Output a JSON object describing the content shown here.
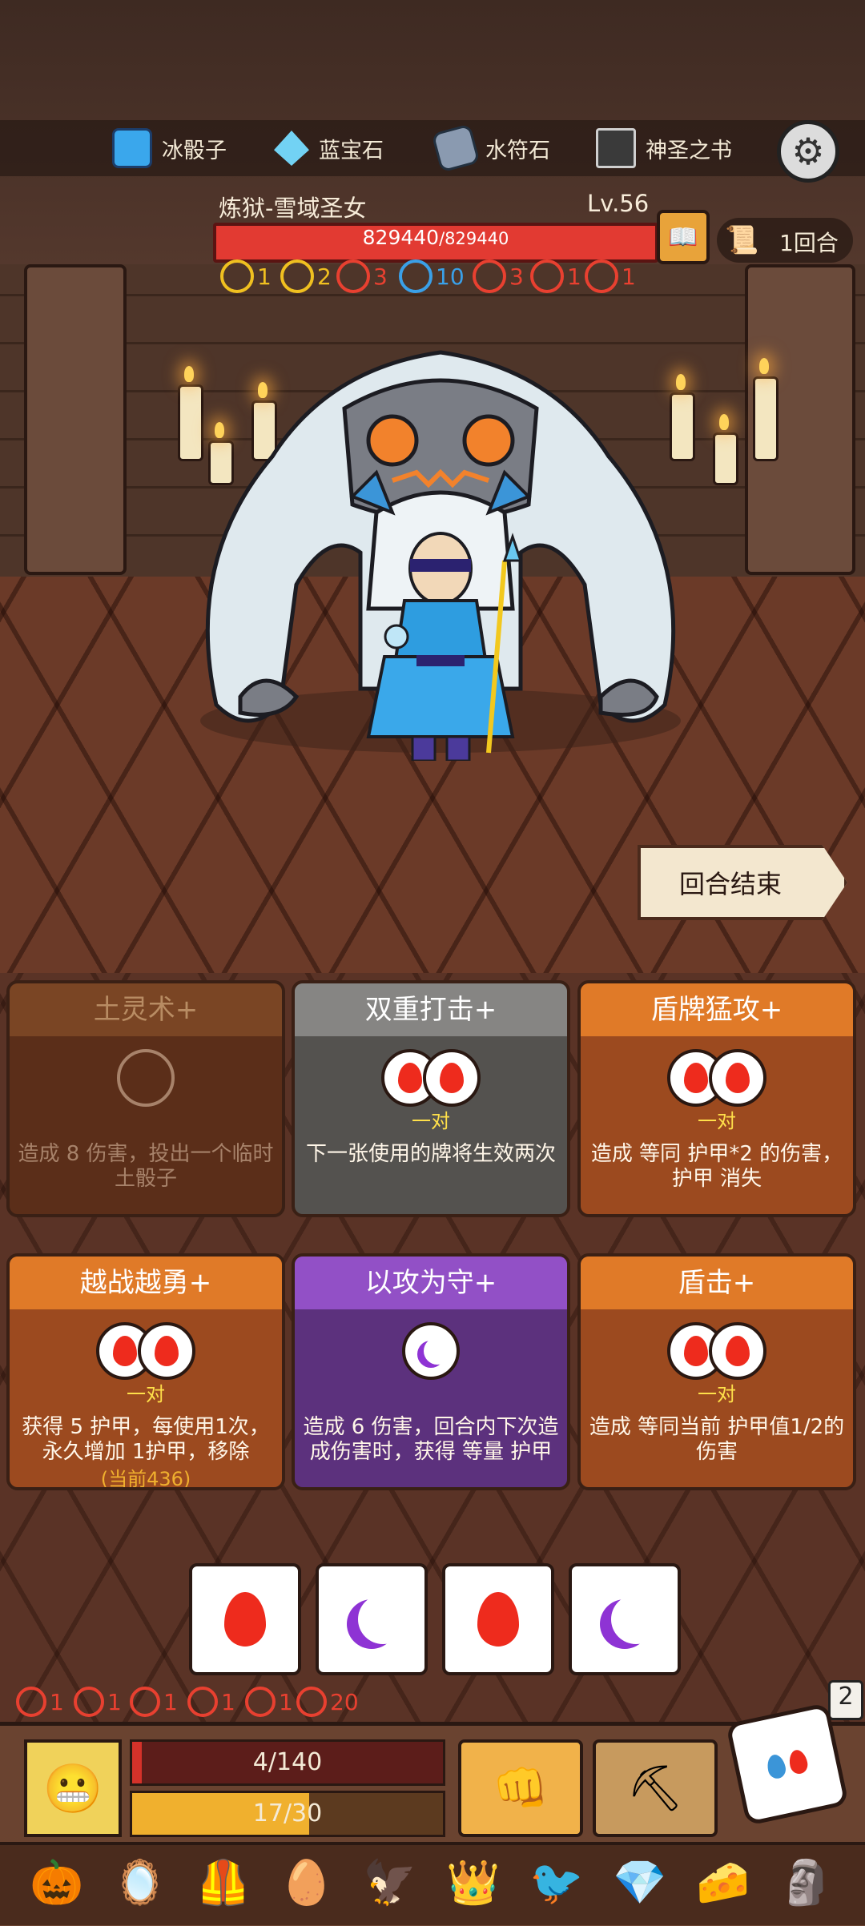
{
  "resources": [
    {
      "icon": "ice-dice-icon",
      "label": "冰骰子"
    },
    {
      "icon": "sapphire-icon",
      "label": "蓝宝石"
    },
    {
      "icon": "water-rune-icon",
      "label": "水符石"
    },
    {
      "icon": "holy-book-icon",
      "label": "神圣之书"
    }
  ],
  "enemy": {
    "name": "炼狱-雪域圣女",
    "level": "Lv.56",
    "hp_current": "829440",
    "hp_max": "/829440",
    "hp_fraction": 1.0,
    "stats": [
      {
        "icon": "shield-icon",
        "value": "1",
        "color": "#f0c020"
      },
      {
        "icon": "star-icon",
        "value": "2",
        "color": "#f0c020"
      },
      {
        "icon": "lightning-icon",
        "value": "3",
        "color": "#e84030"
      },
      {
        "icon": "target-icon",
        "value": "10",
        "color": "#3aa0e8"
      },
      {
        "icon": "hook-icon",
        "value": "3",
        "color": "#e84030"
      },
      {
        "icon": "spiral-icon",
        "value": "1",
        "color": "#e84030"
      },
      {
        "icon": "slash-icon",
        "value": "1",
        "color": "#e84030"
      }
    ]
  },
  "round": {
    "label": "1回合"
  },
  "end_turn": {
    "label": "回合结束"
  },
  "cards": [
    {
      "title": "土灵术+",
      "dice": [
        "rock"
      ],
      "pair": "",
      "desc": "造成 8 伤害，投出一个临时土骰子",
      "style": "c-brown"
    },
    {
      "title": "双重打击+",
      "dice": [
        "fire",
        "fire"
      ],
      "pair": "一对",
      "desc": "下一张使用的牌将生效两次",
      "style": "c-grey"
    },
    {
      "title": "盾牌猛攻+",
      "dice": [
        "fire",
        "fire"
      ],
      "pair": "一对",
      "desc": "造成 等同 护甲*2 的伤害， 护甲 消失",
      "style": "c-orange"
    },
    {
      "title": "越战越勇+",
      "dice": [
        "fire",
        "fire"
      ],
      "pair": "一对",
      "desc": "获得 5 护甲，每使用1次，永久增加 1护甲，移除",
      "sub": "(当前436)",
      "style": "c-orange"
    },
    {
      "title": "以攻为守+",
      "dice": [
        "moon"
      ],
      "pair": "",
      "desc": "造成 6 伤害，回合内下次造成伤害时，获得 等量 护甲",
      "style": "c-purple"
    },
    {
      "title": "盾击+",
      "dice": [
        "fire",
        "fire"
      ],
      "pair": "一对",
      "desc": "造成 等同当前 护甲值1/2的伤害",
      "style": "c-orange"
    }
  ],
  "rolled_dice": [
    "fire",
    "moon",
    "fire",
    "moon"
  ],
  "player_stats": [
    {
      "icon": "spiral-shield-icon",
      "value": "1"
    },
    {
      "icon": "cross-shield-icon",
      "value": "1"
    },
    {
      "icon": "hook-icon",
      "value": "1"
    },
    {
      "icon": "spiral-icon",
      "value": "1"
    },
    {
      "icon": "slash-icon",
      "value": "1"
    },
    {
      "icon": "sun-gear-icon",
      "value": "20"
    }
  ],
  "dice_count": "2",
  "player": {
    "hp": "4/140",
    "hp_fraction": 0.03,
    "energy": "17/30",
    "energy_fraction": 0.57
  },
  "relics": [
    "pumpkin-amulet-icon",
    "mirror-icon",
    "armor-icon",
    "egg-icon",
    "claw-icon",
    "crown-icon",
    "bird-mask-icon",
    "crystal-icon",
    "cheese-icon",
    "totem-icon"
  ]
}
